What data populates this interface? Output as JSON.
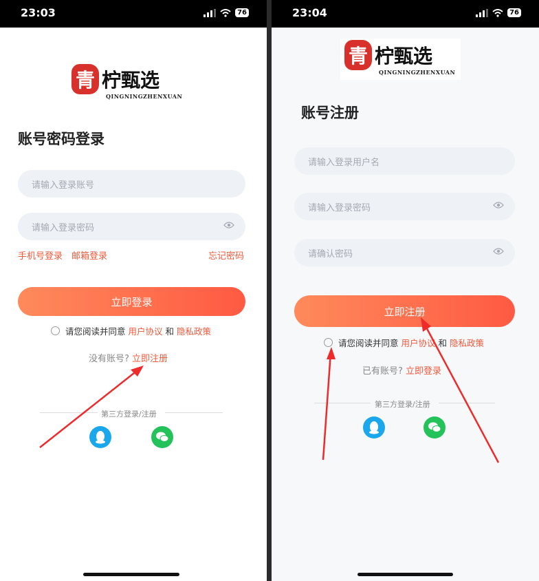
{
  "left": {
    "status": {
      "time": "23:03",
      "battery": "76"
    },
    "logo": {
      "char": "青",
      "text": "柠甄选",
      "sub": "QINGNINGZHENXUAN"
    },
    "title": "账号密码登录",
    "account_placeholder": "请输入登录账号",
    "password_placeholder": "请输入登录密码",
    "links": {
      "phone": "手机号登录",
      "email": "邮箱登录",
      "forgot": "忘记密码"
    },
    "login_button": "立即登录",
    "agree": {
      "prefix": "请您阅读并同意",
      "user": "用户协议",
      "and": "和",
      "privacy": "隐私政策"
    },
    "register_prompt": {
      "text": "没有账号?",
      "link": "立即注册"
    },
    "third": "第三方登录/注册"
  },
  "right": {
    "status": {
      "time": "23:04",
      "battery": "76"
    },
    "logo": {
      "char": "青",
      "text": "柠甄选",
      "sub": "QINGNINGZHENXUAN"
    },
    "title": "账号注册",
    "username_placeholder": "请输入登录用户名",
    "password_placeholder": "请输入登录密码",
    "confirm_placeholder": "请确认密码",
    "register_button": "立即注册",
    "agree": {
      "prefix": "请您阅读并同意",
      "user": "用户协议",
      "and": "和",
      "privacy": "隐私政策"
    },
    "login_prompt": {
      "text": "已有账号?",
      "link": "立即登录"
    },
    "third": "第三方登录/注册"
  },
  "colors": {
    "accent": "#f05a3c",
    "button_start": "#ff8a5b",
    "button_end": "#ff5a43",
    "qq": "#1aa7ec",
    "wechat": "#23c25a"
  },
  "icons": [
    "signal-icon",
    "wifi-icon",
    "battery-icon",
    "eye-icon",
    "qq-icon",
    "wechat-icon",
    "annotation-arrow"
  ]
}
